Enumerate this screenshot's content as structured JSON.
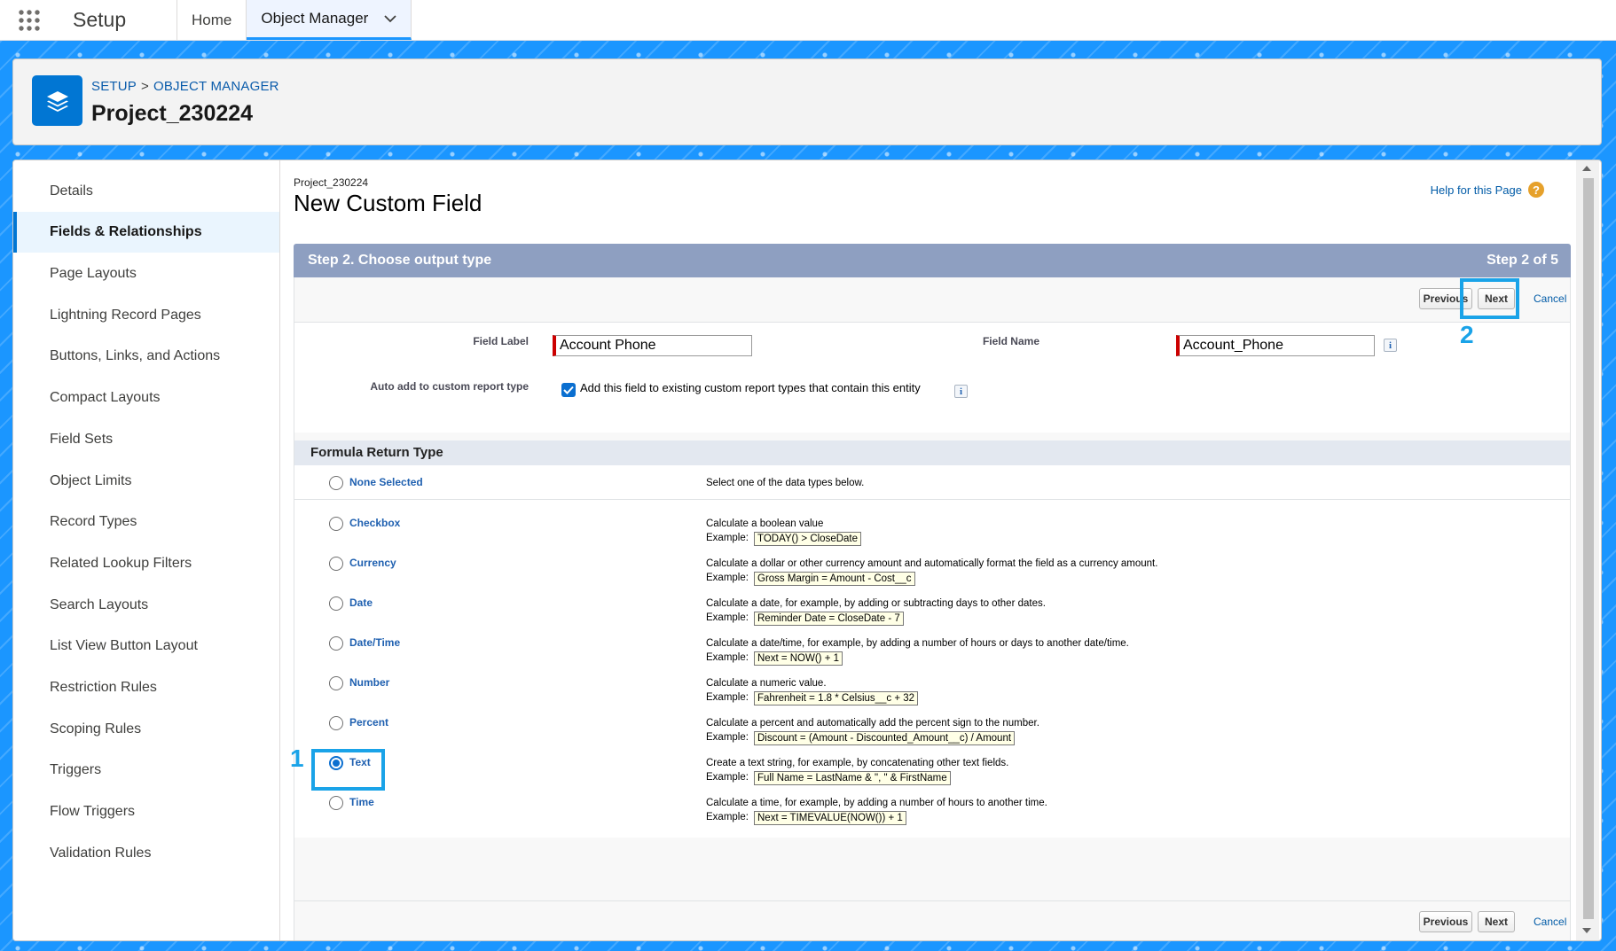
{
  "topnav": {
    "app_name": "Setup",
    "tabs": [
      {
        "label": "Home"
      },
      {
        "label": "Object Manager"
      }
    ]
  },
  "header": {
    "breadcrumb": [
      "SETUP",
      ">",
      "OBJECT MANAGER"
    ],
    "title": "Project_230224"
  },
  "sidebar": {
    "items": [
      {
        "label": "Details"
      },
      {
        "label": "Fields & Relationships",
        "active": true
      },
      {
        "label": "Page Layouts"
      },
      {
        "label": "Lightning Record Pages"
      },
      {
        "label": "Buttons, Links, and Actions"
      },
      {
        "label": "Compact Layouts"
      },
      {
        "label": "Field Sets"
      },
      {
        "label": "Object Limits"
      },
      {
        "label": "Record Types"
      },
      {
        "label": "Related Lookup Filters"
      },
      {
        "label": "Search Layouts"
      },
      {
        "label": "List View Button Layout"
      },
      {
        "label": "Restriction Rules"
      },
      {
        "label": "Scoping Rules"
      },
      {
        "label": "Triggers"
      },
      {
        "label": "Flow Triggers"
      },
      {
        "label": "Validation Rules"
      }
    ]
  },
  "content": {
    "object_name": "Project_230224",
    "title": "New Custom Field",
    "help_link": "Help for this Page",
    "step_title": "Step 2. Choose output type",
    "step_count": "Step 2 of 5",
    "buttons": {
      "previous": "Previous",
      "next": "Next",
      "cancel": "Cancel"
    },
    "field_label_label": "Field Label",
    "field_label_value": "Account Phone",
    "field_name_label": "Field Name",
    "field_name_value": "Account_Phone",
    "auto_add_label": "Auto add to custom report type",
    "auto_add_checked": true,
    "auto_add_text": "Add this field to existing custom report types that contain this entity",
    "section_title": "Formula Return Type",
    "example_label": "Example:",
    "none_selected": {
      "name": "None Selected",
      "desc": "Select one of the data types below."
    },
    "types": [
      {
        "name": "Checkbox",
        "desc": "Calculate a boolean value",
        "example": "TODAY() > CloseDate"
      },
      {
        "name": "Currency",
        "desc": "Calculate a dollar or other currency amount and automatically format the field as a currency amount.",
        "example": "Gross Margin = Amount - Cost__c"
      },
      {
        "name": "Date",
        "desc": "Calculate a date, for example, by adding or subtracting days to other dates.",
        "example": "Reminder Date = CloseDate - 7"
      },
      {
        "name": "Date/Time",
        "desc": "Calculate a date/time, for example, by adding a number of hours or days to another date/time.",
        "example": "Next = NOW() + 1"
      },
      {
        "name": "Number",
        "desc": "Calculate a numeric value.",
        "example": "Fahrenheit = 1.8 * Celsius__c + 32"
      },
      {
        "name": "Percent",
        "desc": "Calculate a percent and automatically add the percent sign to the number.",
        "example": "Discount = (Amount - Discounted_Amount__c) / Amount"
      },
      {
        "name": "Text",
        "desc": "Create a text string, for example, by concatenating other text fields.",
        "example": "Full Name = LastName & \", \" & FirstName",
        "checked": true
      },
      {
        "name": "Time",
        "desc": "Calculate a time, for example, by adding a number of hours to another time.",
        "example": "Next = TIMEVALUE(NOW()) + 1"
      }
    ]
  },
  "annotations": {
    "one": "1",
    "two": "2"
  },
  "colors": {
    "brand_blue": "#1b96ff",
    "annotation": "#1aa3e8",
    "step_bar": "#8e9fc1"
  }
}
